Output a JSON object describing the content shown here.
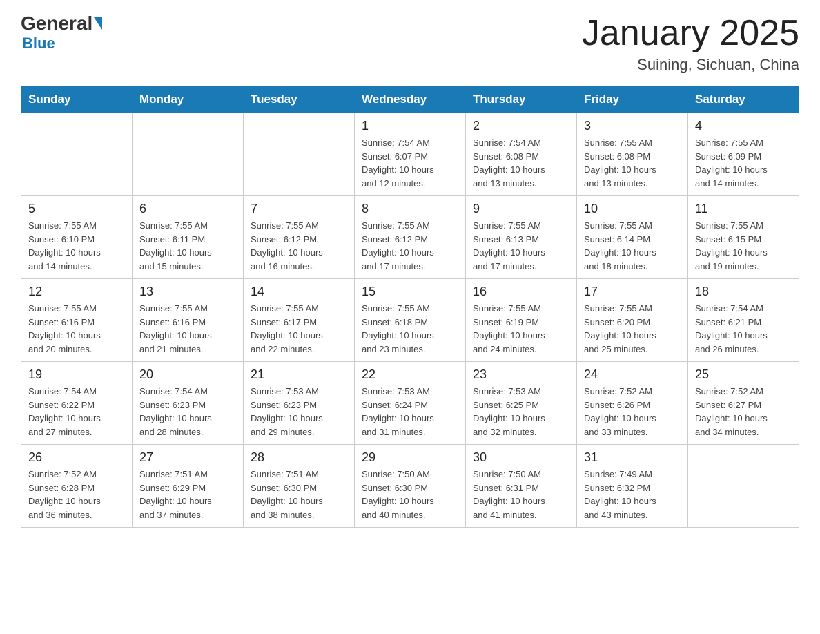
{
  "header": {
    "logo_general": "General",
    "logo_blue": "Blue",
    "calendar_title": "January 2025",
    "calendar_subtitle": "Suining, Sichuan, China"
  },
  "days_of_week": [
    "Sunday",
    "Monday",
    "Tuesday",
    "Wednesday",
    "Thursday",
    "Friday",
    "Saturday"
  ],
  "weeks": [
    [
      {
        "day": "",
        "info": ""
      },
      {
        "day": "",
        "info": ""
      },
      {
        "day": "",
        "info": ""
      },
      {
        "day": "1",
        "info": "Sunrise: 7:54 AM\nSunset: 6:07 PM\nDaylight: 10 hours\nand 12 minutes."
      },
      {
        "day": "2",
        "info": "Sunrise: 7:54 AM\nSunset: 6:08 PM\nDaylight: 10 hours\nand 13 minutes."
      },
      {
        "day": "3",
        "info": "Sunrise: 7:55 AM\nSunset: 6:08 PM\nDaylight: 10 hours\nand 13 minutes."
      },
      {
        "day": "4",
        "info": "Sunrise: 7:55 AM\nSunset: 6:09 PM\nDaylight: 10 hours\nand 14 minutes."
      }
    ],
    [
      {
        "day": "5",
        "info": "Sunrise: 7:55 AM\nSunset: 6:10 PM\nDaylight: 10 hours\nand 14 minutes."
      },
      {
        "day": "6",
        "info": "Sunrise: 7:55 AM\nSunset: 6:11 PM\nDaylight: 10 hours\nand 15 minutes."
      },
      {
        "day": "7",
        "info": "Sunrise: 7:55 AM\nSunset: 6:12 PM\nDaylight: 10 hours\nand 16 minutes."
      },
      {
        "day": "8",
        "info": "Sunrise: 7:55 AM\nSunset: 6:12 PM\nDaylight: 10 hours\nand 17 minutes."
      },
      {
        "day": "9",
        "info": "Sunrise: 7:55 AM\nSunset: 6:13 PM\nDaylight: 10 hours\nand 17 minutes."
      },
      {
        "day": "10",
        "info": "Sunrise: 7:55 AM\nSunset: 6:14 PM\nDaylight: 10 hours\nand 18 minutes."
      },
      {
        "day": "11",
        "info": "Sunrise: 7:55 AM\nSunset: 6:15 PM\nDaylight: 10 hours\nand 19 minutes."
      }
    ],
    [
      {
        "day": "12",
        "info": "Sunrise: 7:55 AM\nSunset: 6:16 PM\nDaylight: 10 hours\nand 20 minutes."
      },
      {
        "day": "13",
        "info": "Sunrise: 7:55 AM\nSunset: 6:16 PM\nDaylight: 10 hours\nand 21 minutes."
      },
      {
        "day": "14",
        "info": "Sunrise: 7:55 AM\nSunset: 6:17 PM\nDaylight: 10 hours\nand 22 minutes."
      },
      {
        "day": "15",
        "info": "Sunrise: 7:55 AM\nSunset: 6:18 PM\nDaylight: 10 hours\nand 23 minutes."
      },
      {
        "day": "16",
        "info": "Sunrise: 7:55 AM\nSunset: 6:19 PM\nDaylight: 10 hours\nand 24 minutes."
      },
      {
        "day": "17",
        "info": "Sunrise: 7:55 AM\nSunset: 6:20 PM\nDaylight: 10 hours\nand 25 minutes."
      },
      {
        "day": "18",
        "info": "Sunrise: 7:54 AM\nSunset: 6:21 PM\nDaylight: 10 hours\nand 26 minutes."
      }
    ],
    [
      {
        "day": "19",
        "info": "Sunrise: 7:54 AM\nSunset: 6:22 PM\nDaylight: 10 hours\nand 27 minutes."
      },
      {
        "day": "20",
        "info": "Sunrise: 7:54 AM\nSunset: 6:23 PM\nDaylight: 10 hours\nand 28 minutes."
      },
      {
        "day": "21",
        "info": "Sunrise: 7:53 AM\nSunset: 6:23 PM\nDaylight: 10 hours\nand 29 minutes."
      },
      {
        "day": "22",
        "info": "Sunrise: 7:53 AM\nSunset: 6:24 PM\nDaylight: 10 hours\nand 31 minutes."
      },
      {
        "day": "23",
        "info": "Sunrise: 7:53 AM\nSunset: 6:25 PM\nDaylight: 10 hours\nand 32 minutes."
      },
      {
        "day": "24",
        "info": "Sunrise: 7:52 AM\nSunset: 6:26 PM\nDaylight: 10 hours\nand 33 minutes."
      },
      {
        "day": "25",
        "info": "Sunrise: 7:52 AM\nSunset: 6:27 PM\nDaylight: 10 hours\nand 34 minutes."
      }
    ],
    [
      {
        "day": "26",
        "info": "Sunrise: 7:52 AM\nSunset: 6:28 PM\nDaylight: 10 hours\nand 36 minutes."
      },
      {
        "day": "27",
        "info": "Sunrise: 7:51 AM\nSunset: 6:29 PM\nDaylight: 10 hours\nand 37 minutes."
      },
      {
        "day": "28",
        "info": "Sunrise: 7:51 AM\nSunset: 6:30 PM\nDaylight: 10 hours\nand 38 minutes."
      },
      {
        "day": "29",
        "info": "Sunrise: 7:50 AM\nSunset: 6:30 PM\nDaylight: 10 hours\nand 40 minutes."
      },
      {
        "day": "30",
        "info": "Sunrise: 7:50 AM\nSunset: 6:31 PM\nDaylight: 10 hours\nand 41 minutes."
      },
      {
        "day": "31",
        "info": "Sunrise: 7:49 AM\nSunset: 6:32 PM\nDaylight: 10 hours\nand 43 minutes."
      },
      {
        "day": "",
        "info": ""
      }
    ]
  ]
}
